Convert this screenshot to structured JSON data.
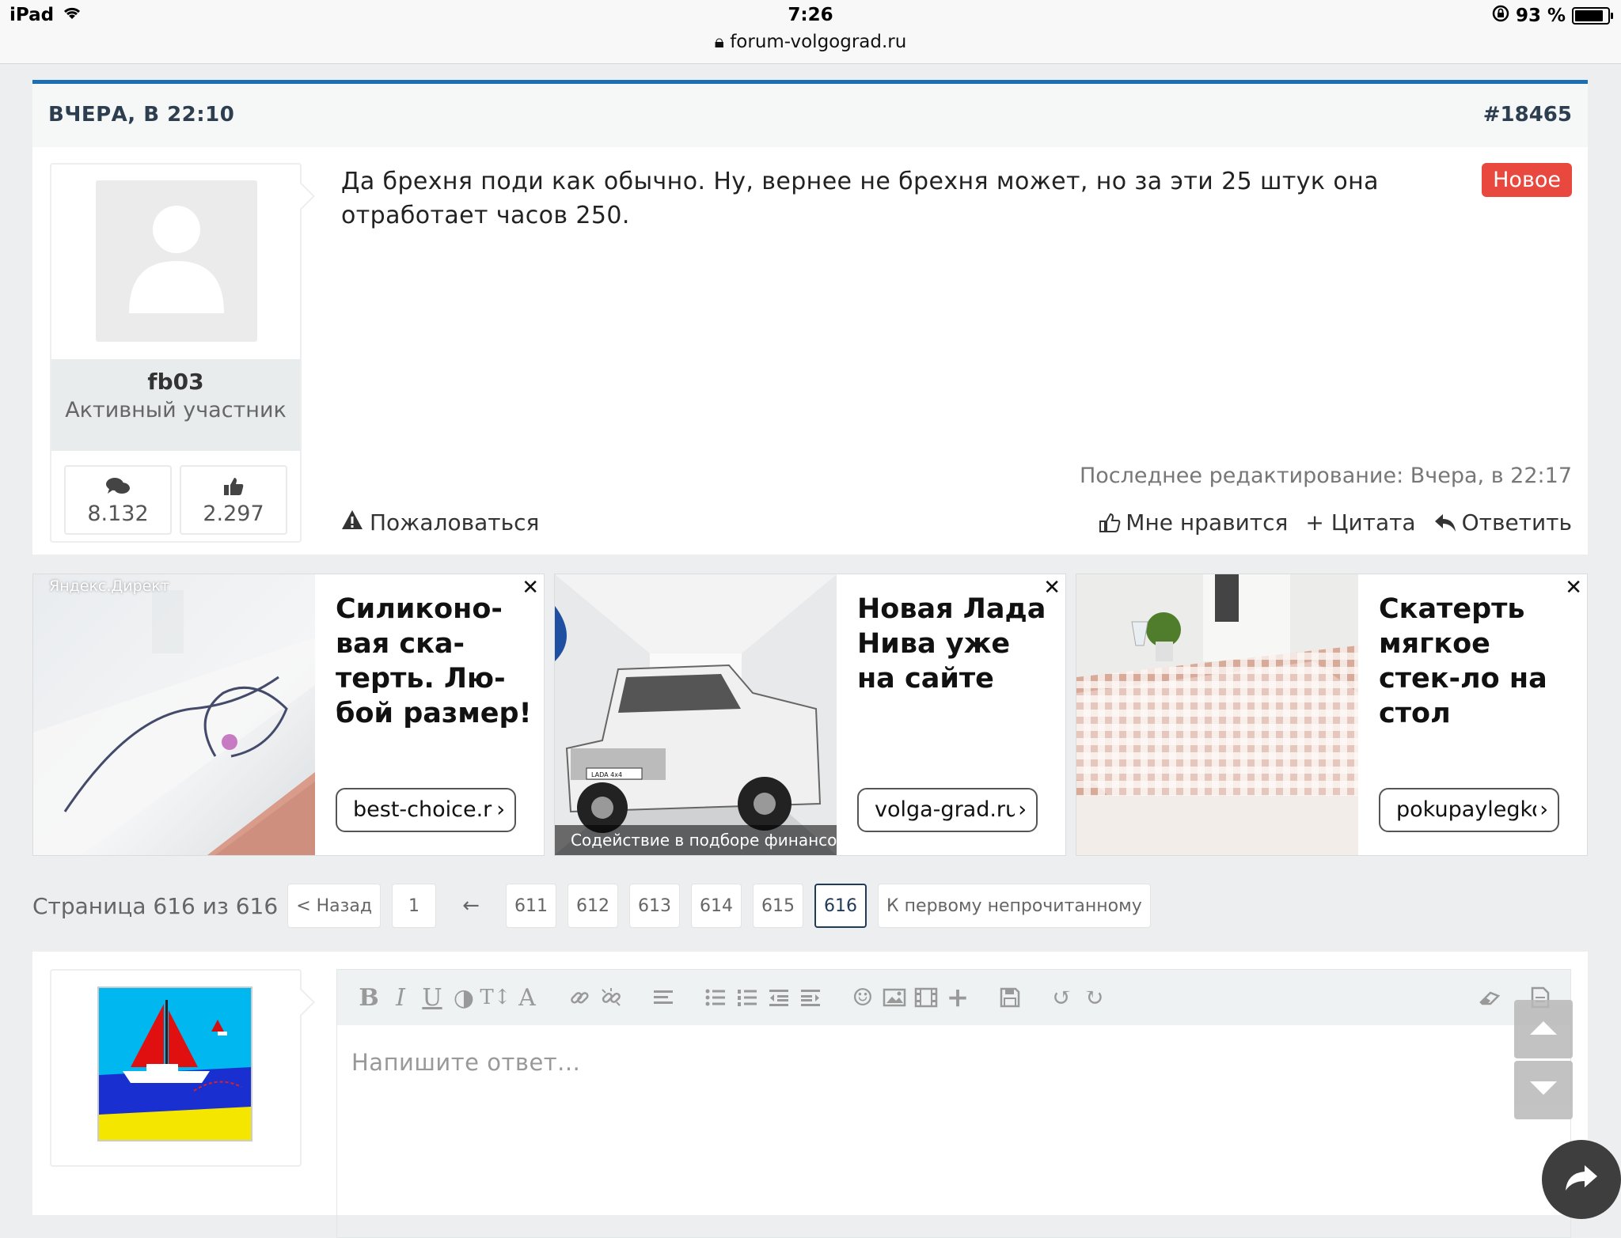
{
  "status_bar": {
    "device": "iPad",
    "time": "7:26",
    "url": "forum-volgograd.ru",
    "battery": "93 %",
    "battery_level": 0.93
  },
  "post": {
    "date": "ВЧЕРА, В 22:10",
    "number": "#18465",
    "author": {
      "name": "fb03",
      "rank": "Активный участник",
      "messages": "8.132",
      "likes": "2.297"
    },
    "text": "Да брехня поди как обычно. Ну, вернее не брехня может, но за эти 25 штук она отработает часов 250.",
    "badge": "Новое",
    "last_edit": "Последнее редактирование: Вчера, в 22:17",
    "report_label": "Пожаловаться",
    "like_label": "Мне нравится",
    "quote_label": "+ Цитата",
    "reply_label": "Ответить"
  },
  "ads": [
    {
      "overlay": "Яндекс.Директ",
      "title": "Силиконо-вая ска-терть. Лю-бой размер!",
      "button": "best-choice.r",
      "close": "✕"
    },
    {
      "title": "Новая Лада Нива уже на сайте",
      "caption": "Содействие в подборе финансо",
      "button": "volga-grad.ru",
      "close": "✕",
      "car_plate": "LADA 4x4"
    },
    {
      "title": "Скатерть мягкое стек-ло на стол",
      "button": "pokupaylegko",
      "close": "✕"
    }
  ],
  "pagination": {
    "label": "Страница 616 из 616",
    "prev": "< Назад",
    "first": "1",
    "ellipsis_arrow": "←",
    "pages": [
      "611",
      "612",
      "613",
      "614",
      "615"
    ],
    "current": "616",
    "unread": "К первому непрочитанному"
  },
  "editor": {
    "placeholder": "Напишите ответ...",
    "toolbar_letters": {
      "bold": "B",
      "italic": "I",
      "underline": "U",
      "text_size": "T↕",
      "font": "A"
    }
  },
  "colors": {
    "accent_blue": "#1a6fb5",
    "new_badge": "#e8483d",
    "heading": "#2c3e50"
  }
}
